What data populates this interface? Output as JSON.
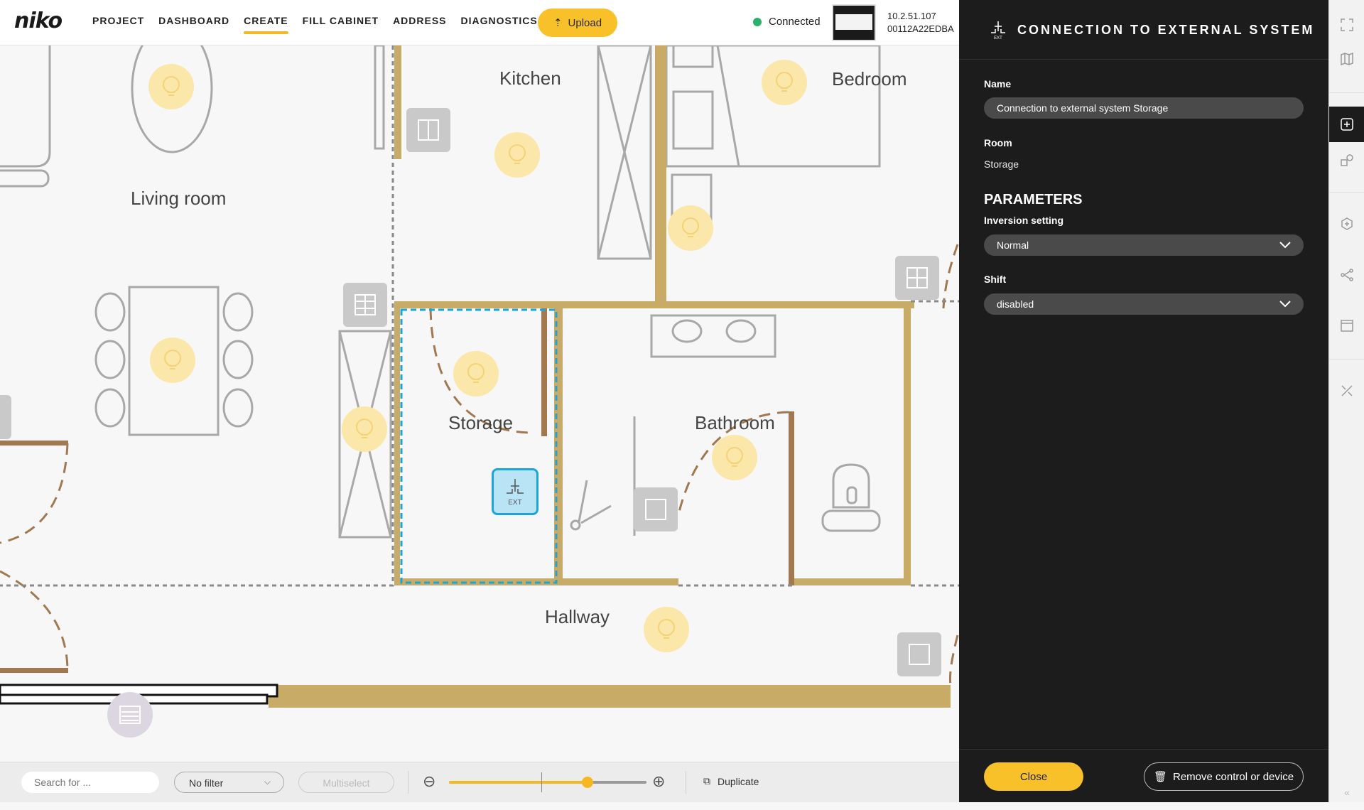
{
  "app": {
    "logo": "niko"
  },
  "nav": {
    "items": [
      {
        "label": "PROJECT",
        "active": false
      },
      {
        "label": "DASHBOARD",
        "active": false
      },
      {
        "label": "CREATE",
        "active": true
      },
      {
        "label": "FILL CABINET",
        "active": false
      },
      {
        "label": "ADDRESS",
        "active": false
      },
      {
        "label": "DIAGNOSTICS",
        "active": false,
        "external": true
      }
    ],
    "upload_label": "Upload"
  },
  "connection": {
    "status": "Connected",
    "status_color": "#29b06c",
    "ip": "10.2.51.107",
    "mac": "00112A22EDBA"
  },
  "floorplan": {
    "rooms": [
      "Living room",
      "Kitchen",
      "Bedroom",
      "Storage",
      "Bathroom",
      "Hallway"
    ],
    "selected_device": "EXT"
  },
  "toolbar": {
    "search_placeholder": "Search for ...",
    "filter_value": "No filter",
    "multiselect_label": "Multiselect",
    "zoom_level": 0.7,
    "duplicate_label": "Duplicate"
  },
  "panel": {
    "title": "CONNECTION TO EXTERNAL SYSTEM",
    "name_label": "Name",
    "name_value": "Connection to external system Storage",
    "room_label": "Room",
    "room_value": "Storage",
    "parameters_heading": "PARAMETERS",
    "inversion_label": "Inversion setting",
    "inversion_value": "Normal",
    "shift_label": "Shift",
    "shift_value": "disabled",
    "close_label": "Close",
    "remove_label": "Remove control or device"
  },
  "rail_icons": [
    "fullscreen-icon",
    "map-icon",
    "add-device-icon",
    "add-shapes-icon",
    "add-hexagon-icon",
    "connections-icon",
    "calendar-icon",
    "tools-icon"
  ],
  "colors": {
    "accent": "#f8c029",
    "panel_bg": "#1c1c1c",
    "selection": "#1aa6d9"
  }
}
